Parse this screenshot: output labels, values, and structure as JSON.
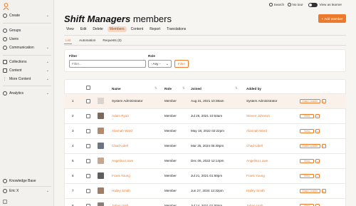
{
  "sidebar": {
    "items": [
      {
        "label": "Create",
        "icon": "plus-circle-icon",
        "chev": "⌄"
      },
      {
        "label": "Groups",
        "icon": "groups-icon"
      },
      {
        "label": "Users",
        "icon": "users-icon"
      },
      {
        "label": "Communication",
        "icon": "chat-icon",
        "chev": "⌄"
      },
      {
        "label": "Collections",
        "icon": "collections-icon",
        "chev": "⌄"
      },
      {
        "label": "Content",
        "icon": "content-icon",
        "chev": "⌄"
      },
      {
        "label": "More Content",
        "icon": "more-content-icon",
        "chev": "⌄"
      },
      {
        "label": "Analytics",
        "icon": "analytics-icon",
        "chev": "⌄"
      }
    ],
    "knowledge_base": "Knowledge Base",
    "user": "Eric X",
    "user_chev": "⌄",
    "collapse_glyph": "‹"
  },
  "topbar": {
    "search": "Search",
    "tour": "No tour",
    "view_as": "View as learner"
  },
  "header": {
    "group_name": "Shift Managers",
    "title_suffix": "members",
    "add_button": "+ Add member"
  },
  "tabs": [
    "View",
    "Edit",
    "Delete",
    "Members",
    "Content",
    "Report",
    "Translations"
  ],
  "active_tab": "Members",
  "subtabs": [
    "List",
    "Automation",
    "Requests (0)"
  ],
  "filter": {
    "filter_label": "Filter",
    "filter_placeholder": "Filter...",
    "role_label": "Role",
    "role_value": "- Any -",
    "button": "Filter"
  },
  "table": {
    "columns": [
      "Name",
      "Role",
      "Joined",
      "Added by"
    ],
    "sort_glyph": "⇅",
    "rows": [
      {
        "num": "1",
        "name": "System Administrator",
        "role": "Member",
        "joined": "Aug 31, 2021 10:38am",
        "added_by": "System Administrator",
        "action": "Make Leader",
        "name_link": false
      },
      {
        "num": "2",
        "name": "Adam Ryan",
        "role": "Member",
        "joined": "Jul 26, 2021 10:53am",
        "added_by": "Steven Johnson",
        "action": "View",
        "name_link": true
      },
      {
        "num": "3",
        "name": "Alannah Ward",
        "role": "Member",
        "joined": "May 18, 2022 02:22pm",
        "added_by": "Alannah Ward",
        "action": "View",
        "name_link": true
      },
      {
        "num": "4",
        "name": "Chad Udell",
        "role": "Member",
        "joined": "Mar 25, 2024 05:48pm",
        "added_by": "Chad Udell",
        "action": "Make Leader",
        "name_link": true
      },
      {
        "num": "5",
        "name": "Angelina Lowe",
        "role": "Member",
        "joined": "Dec 06, 2022 12:14pm",
        "added_by": "Angelina Lowe",
        "action": "View",
        "name_link": true
      },
      {
        "num": "6",
        "name": "Frank Young",
        "role": "Member",
        "joined": "Jul 21, 2021 01:50pm",
        "added_by": "Frank Young",
        "action": "View",
        "name_link": true
      },
      {
        "num": "7",
        "name": "Hailey Smith",
        "role": "Member",
        "joined": "Jun 27, 2024 12:32pm",
        "added_by": "Hailey Smith",
        "action": "Make Leader",
        "name_link": true
      },
      {
        "num": "8",
        "name": "Jaban Ursh",
        "role": "Member",
        "joined": "Jul 14, 2021 01:00pm",
        "added_by": "Jaban Ursh",
        "action": "View",
        "name_link": true
      }
    ],
    "action_dd": "⌄"
  },
  "colors": {
    "accent": "#ec7a2b",
    "active_tab_bg": "#f3d8c6"
  }
}
